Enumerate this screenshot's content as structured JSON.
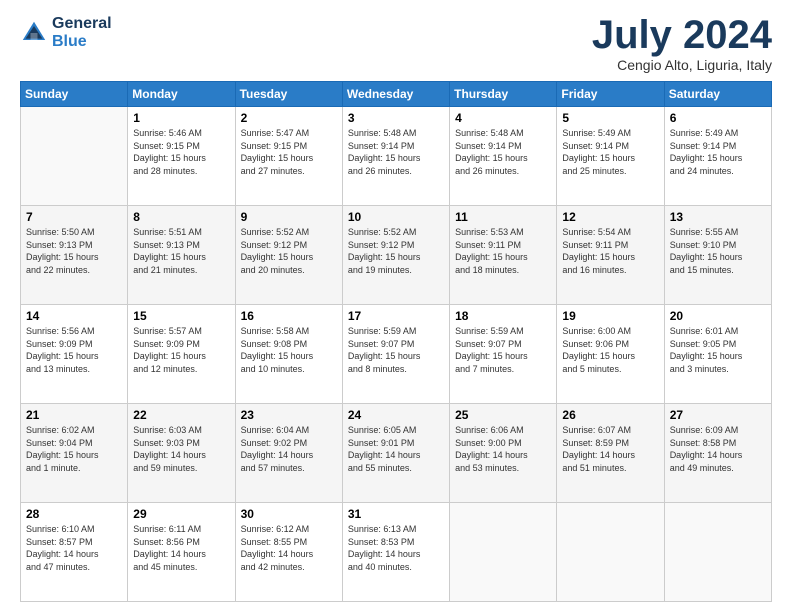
{
  "header": {
    "logo_line1": "General",
    "logo_line2": "Blue",
    "month_title": "July 2024",
    "location": "Cengio Alto, Liguria, Italy"
  },
  "weekdays": [
    "Sunday",
    "Monday",
    "Tuesday",
    "Wednesday",
    "Thursday",
    "Friday",
    "Saturday"
  ],
  "weeks": [
    [
      {
        "day": "",
        "info": ""
      },
      {
        "day": "1",
        "info": "Sunrise: 5:46 AM\nSunset: 9:15 PM\nDaylight: 15 hours\nand 28 minutes."
      },
      {
        "day": "2",
        "info": "Sunrise: 5:47 AM\nSunset: 9:15 PM\nDaylight: 15 hours\nand 27 minutes."
      },
      {
        "day": "3",
        "info": "Sunrise: 5:48 AM\nSunset: 9:14 PM\nDaylight: 15 hours\nand 26 minutes."
      },
      {
        "day": "4",
        "info": "Sunrise: 5:48 AM\nSunset: 9:14 PM\nDaylight: 15 hours\nand 26 minutes."
      },
      {
        "day": "5",
        "info": "Sunrise: 5:49 AM\nSunset: 9:14 PM\nDaylight: 15 hours\nand 25 minutes."
      },
      {
        "day": "6",
        "info": "Sunrise: 5:49 AM\nSunset: 9:14 PM\nDaylight: 15 hours\nand 24 minutes."
      }
    ],
    [
      {
        "day": "7",
        "info": "Sunrise: 5:50 AM\nSunset: 9:13 PM\nDaylight: 15 hours\nand 22 minutes."
      },
      {
        "day": "8",
        "info": "Sunrise: 5:51 AM\nSunset: 9:13 PM\nDaylight: 15 hours\nand 21 minutes."
      },
      {
        "day": "9",
        "info": "Sunrise: 5:52 AM\nSunset: 9:12 PM\nDaylight: 15 hours\nand 20 minutes."
      },
      {
        "day": "10",
        "info": "Sunrise: 5:52 AM\nSunset: 9:12 PM\nDaylight: 15 hours\nand 19 minutes."
      },
      {
        "day": "11",
        "info": "Sunrise: 5:53 AM\nSunset: 9:11 PM\nDaylight: 15 hours\nand 18 minutes."
      },
      {
        "day": "12",
        "info": "Sunrise: 5:54 AM\nSunset: 9:11 PM\nDaylight: 15 hours\nand 16 minutes."
      },
      {
        "day": "13",
        "info": "Sunrise: 5:55 AM\nSunset: 9:10 PM\nDaylight: 15 hours\nand 15 minutes."
      }
    ],
    [
      {
        "day": "14",
        "info": "Sunrise: 5:56 AM\nSunset: 9:09 PM\nDaylight: 15 hours\nand 13 minutes."
      },
      {
        "day": "15",
        "info": "Sunrise: 5:57 AM\nSunset: 9:09 PM\nDaylight: 15 hours\nand 12 minutes."
      },
      {
        "day": "16",
        "info": "Sunrise: 5:58 AM\nSunset: 9:08 PM\nDaylight: 15 hours\nand 10 minutes."
      },
      {
        "day": "17",
        "info": "Sunrise: 5:59 AM\nSunset: 9:07 PM\nDaylight: 15 hours\nand 8 minutes."
      },
      {
        "day": "18",
        "info": "Sunrise: 5:59 AM\nSunset: 9:07 PM\nDaylight: 15 hours\nand 7 minutes."
      },
      {
        "day": "19",
        "info": "Sunrise: 6:00 AM\nSunset: 9:06 PM\nDaylight: 15 hours\nand 5 minutes."
      },
      {
        "day": "20",
        "info": "Sunrise: 6:01 AM\nSunset: 9:05 PM\nDaylight: 15 hours\nand 3 minutes."
      }
    ],
    [
      {
        "day": "21",
        "info": "Sunrise: 6:02 AM\nSunset: 9:04 PM\nDaylight: 15 hours\nand 1 minute."
      },
      {
        "day": "22",
        "info": "Sunrise: 6:03 AM\nSunset: 9:03 PM\nDaylight: 14 hours\nand 59 minutes."
      },
      {
        "day": "23",
        "info": "Sunrise: 6:04 AM\nSunset: 9:02 PM\nDaylight: 14 hours\nand 57 minutes."
      },
      {
        "day": "24",
        "info": "Sunrise: 6:05 AM\nSunset: 9:01 PM\nDaylight: 14 hours\nand 55 minutes."
      },
      {
        "day": "25",
        "info": "Sunrise: 6:06 AM\nSunset: 9:00 PM\nDaylight: 14 hours\nand 53 minutes."
      },
      {
        "day": "26",
        "info": "Sunrise: 6:07 AM\nSunset: 8:59 PM\nDaylight: 14 hours\nand 51 minutes."
      },
      {
        "day": "27",
        "info": "Sunrise: 6:09 AM\nSunset: 8:58 PM\nDaylight: 14 hours\nand 49 minutes."
      }
    ],
    [
      {
        "day": "28",
        "info": "Sunrise: 6:10 AM\nSunset: 8:57 PM\nDaylight: 14 hours\nand 47 minutes."
      },
      {
        "day": "29",
        "info": "Sunrise: 6:11 AM\nSunset: 8:56 PM\nDaylight: 14 hours\nand 45 minutes."
      },
      {
        "day": "30",
        "info": "Sunrise: 6:12 AM\nSunset: 8:55 PM\nDaylight: 14 hours\nand 42 minutes."
      },
      {
        "day": "31",
        "info": "Sunrise: 6:13 AM\nSunset: 8:53 PM\nDaylight: 14 hours\nand 40 minutes."
      },
      {
        "day": "",
        "info": ""
      },
      {
        "day": "",
        "info": ""
      },
      {
        "day": "",
        "info": ""
      }
    ]
  ]
}
